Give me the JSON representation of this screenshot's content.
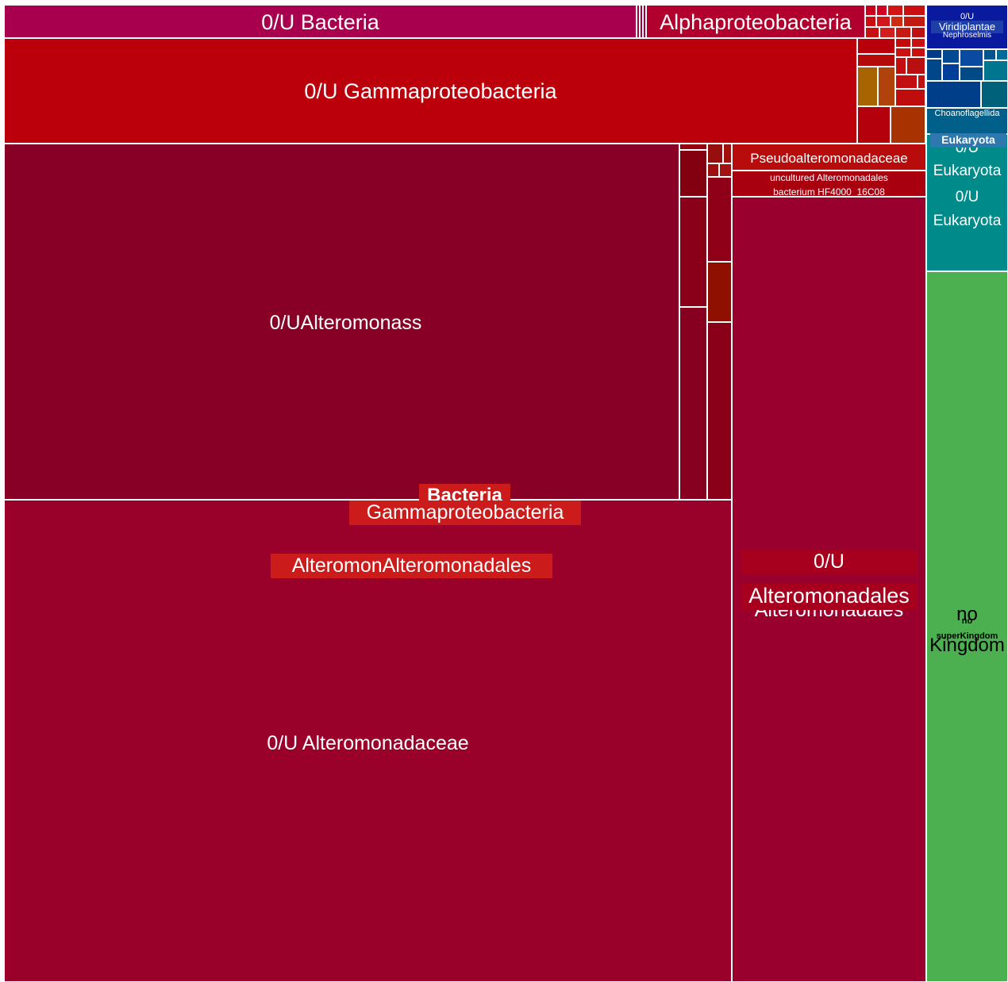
{
  "chart_data": {
    "type": "treemap",
    "root": "Bacteria",
    "labels": {
      "u_bacteria": "0/U Bacteria",
      "alphaproteobacteria": "Alphaproteobacteria",
      "u_gammaproteobacteria": "0/U Gammaproteobacteria",
      "u_alteromonas": "0/UAlteromonass",
      "pseudoalteromonadaceae": "Pseudoalteromonadaceae",
      "uncultured_hf4000": "uncultured Alteromonadales bacterium HF4000_16C08",
      "bacteria": "Bacteria",
      "gammaproteobacteria": "Gammaproteobacteria",
      "alteromonadales_overlap": "AlteromonAlteromonadales",
      "u_alteromonadaceae": "0/U Alteromonadaceae",
      "u_alteromonadales_top": "0/U",
      "u_alteromonadales_mid": "Alteromonadales",
      "u_alteromonadales_under": "Alteromonadales",
      "u_viridiplantae": "0/U",
      "viridiplantae": "Viridiplantae",
      "nephroselmis": "Nephroselmis",
      "choanoflagellida": "Choanoflagellida",
      "eukaryota": "Eukaryota",
      "u_eukaryota_1a": "0/U",
      "u_eukaryota_1b": "Eukaryota",
      "u_eukaryota_2a": "0/U",
      "u_eukaryota_2b": "Eukaryota",
      "no_kingdom_a": "no",
      "no_kingdom_b": "Kingdom",
      "no_superkingdom_a": "no",
      "no_superkingdom_b": "superKingdom"
    },
    "colors": {
      "bacteria_crimson": "#99002a",
      "alteromonas_dark": "#880026",
      "gamma_red": "#bb000c",
      "u_bacteria_magenta": "#a8004f",
      "eukaryota_teal": "#008b8b",
      "eukaryota_blue": "#003e8a",
      "no_kingdom_green": "#4caf50",
      "label_highlight": "#cc1b1b"
    }
  }
}
